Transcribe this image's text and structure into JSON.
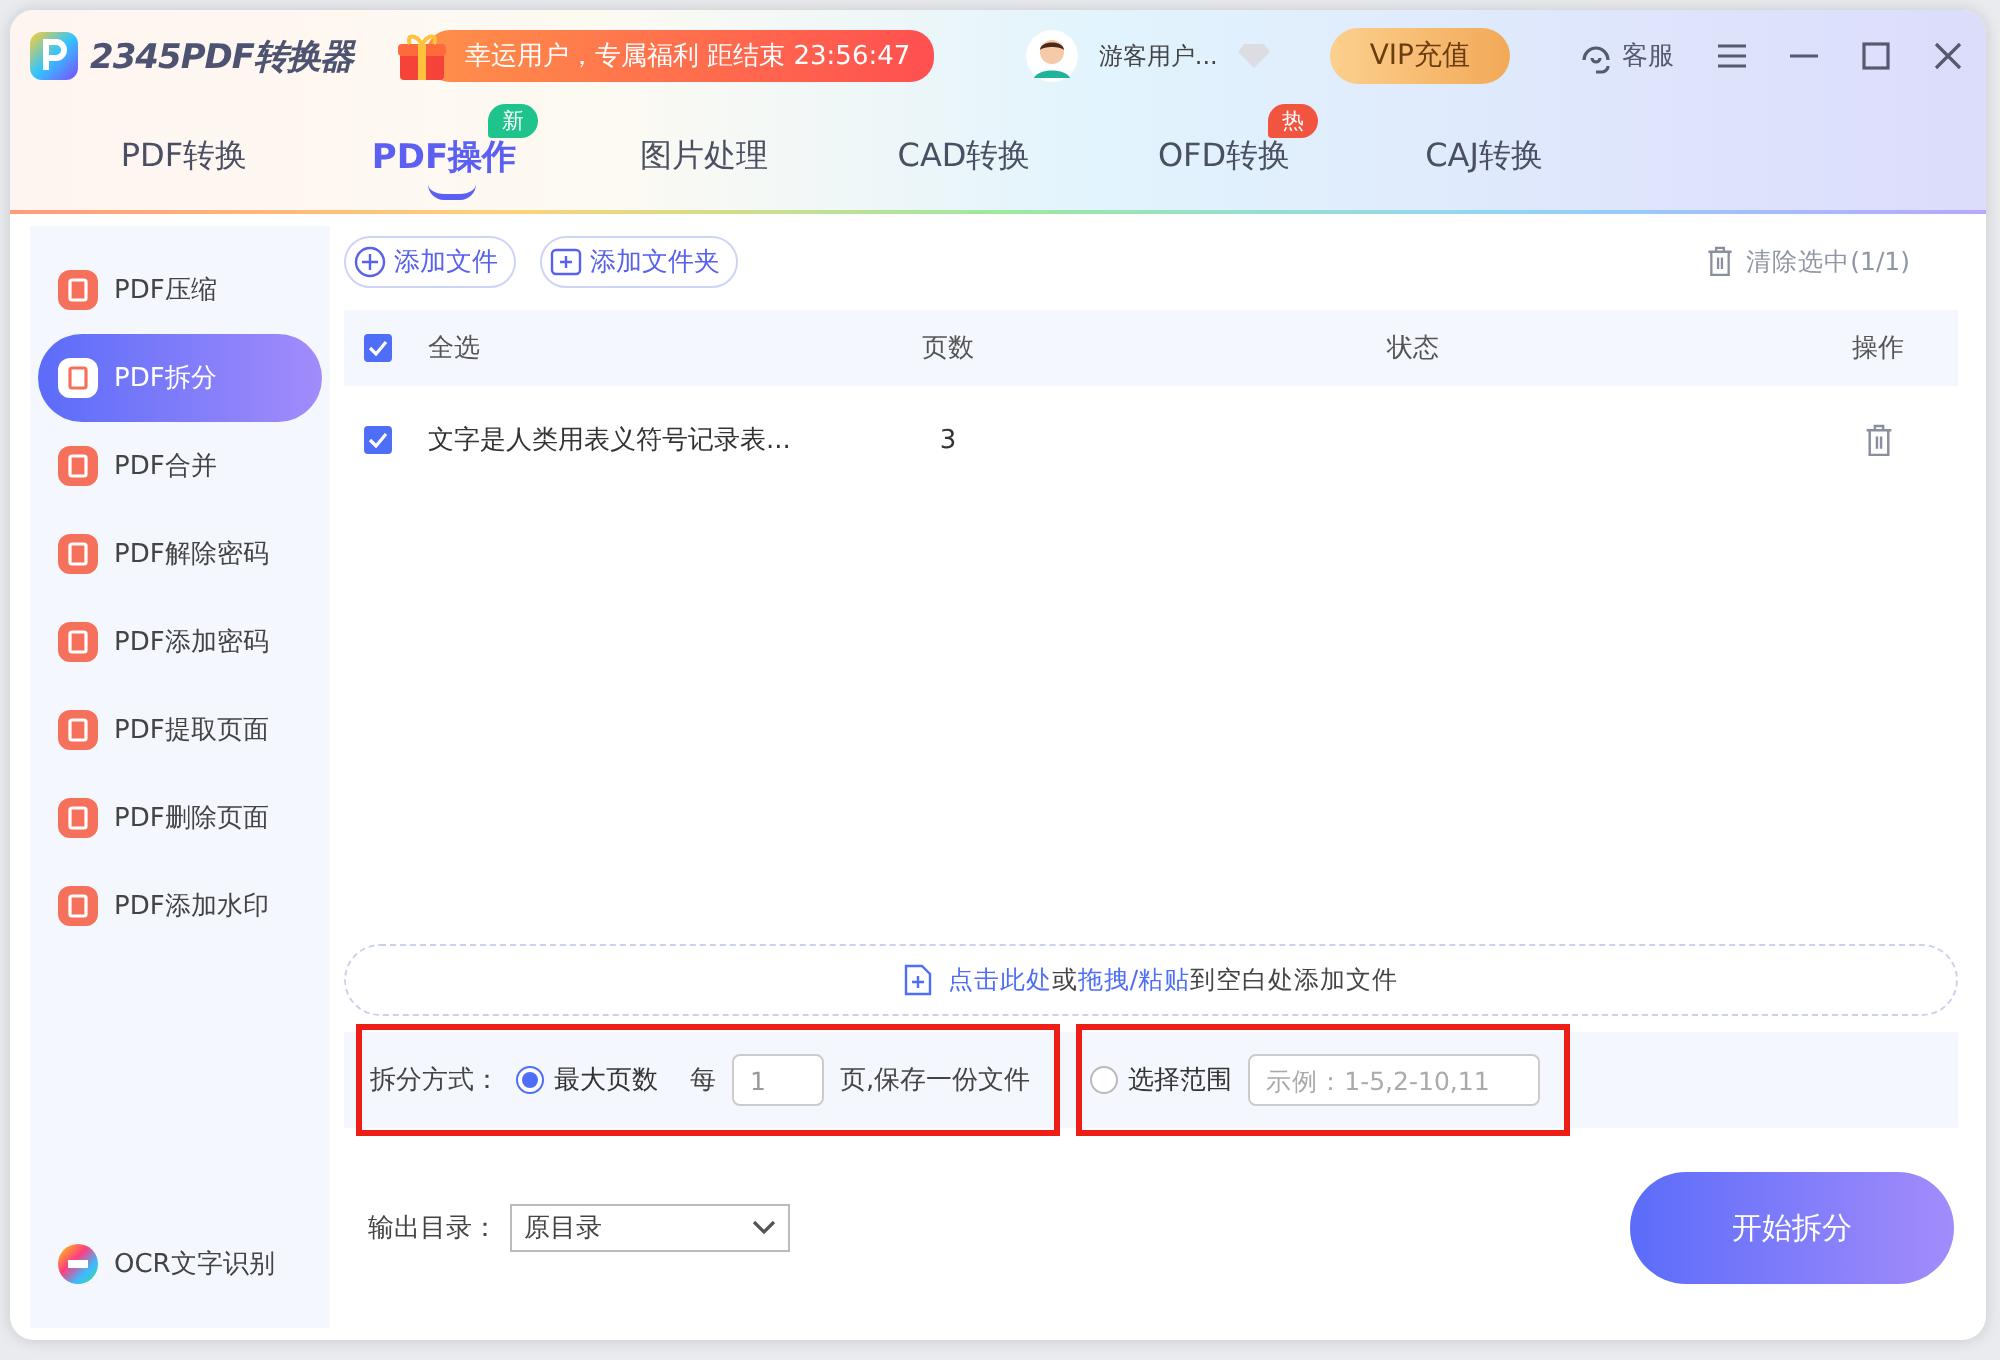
{
  "app": {
    "logo_text": "2345PDF转换器",
    "promo": "幸运用户，专属福利 距结束 23:56:47",
    "user": "游客用户...",
    "vip_button": "VIP充值",
    "service": "客服"
  },
  "tabs": [
    {
      "label": "PDF转换",
      "selected": false
    },
    {
      "label": "PDF操作",
      "selected": true,
      "badge": {
        "text": "新",
        "color": "#1fc48c"
      }
    },
    {
      "label": "图片处理",
      "selected": false
    },
    {
      "label": "CAD转换",
      "selected": false
    },
    {
      "label": "OFD转换",
      "selected": false,
      "badge": {
        "text": "热",
        "color": "#f2553f"
      }
    },
    {
      "label": "CAJ转换",
      "selected": false
    }
  ],
  "sidebar": {
    "items": [
      {
        "label": "PDF压缩",
        "selected": false
      },
      {
        "label": "PDF拆分",
        "selected": true
      },
      {
        "label": "PDF合并",
        "selected": false
      },
      {
        "label": "PDF解除密码",
        "selected": false
      },
      {
        "label": "PDF添加密码",
        "selected": false
      },
      {
        "label": "PDF提取页面",
        "selected": false
      },
      {
        "label": "PDF删除页面",
        "selected": false
      },
      {
        "label": "PDF添加水印",
        "selected": false
      }
    ],
    "footer": "OCR文字识别"
  },
  "toolbar": {
    "add_file": "添加文件",
    "add_folder": "添加文件夹",
    "clear": "清除选中(1/1)"
  },
  "table": {
    "select_all": {
      "label": "全选",
      "checked": true
    },
    "columns": [
      "页数",
      "状态",
      "操作"
    ],
    "rows": [
      {
        "name": "文字是人类用表义符号记录表...",
        "pages": "3",
        "checked": true
      }
    ]
  },
  "drop_hint": [
    {
      "text": "点击此处",
      "link": true
    },
    {
      "text": "或",
      "link": false
    },
    {
      "text": "拖拽/粘贴",
      "link": true
    },
    {
      "text": "到空白处添加文件",
      "link": false
    }
  ],
  "split": {
    "label": "拆分方式：",
    "options": [
      {
        "kind": "per_page",
        "label": "最大页数",
        "selected": true,
        "highlighted": true,
        "prefix": "每",
        "value": "1",
        "suffix": "页,保存一份文件"
      },
      {
        "kind": "range",
        "label": "选择范围",
        "selected": false,
        "highlighted": true,
        "placeholder": "示例：1-5,2-10,11"
      }
    ]
  },
  "output": {
    "label": "输出目录：",
    "value": "原目录"
  },
  "start_button": "开始拆分"
}
